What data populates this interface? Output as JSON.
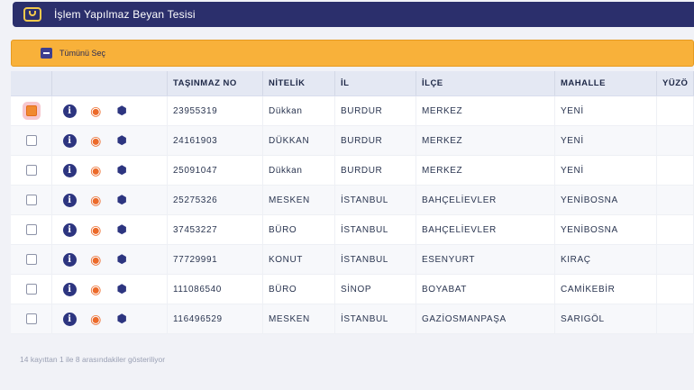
{
  "window": {
    "title": "İşlem Yapılmaz Beyan Tesisi"
  },
  "toolbar": {
    "select_all_label": "Tümünü Seç"
  },
  "table": {
    "headers": {
      "no": "TAŞINMAZ NO",
      "nitelik": "NİTELİK",
      "il": "İL",
      "ilce": "İLÇE",
      "mahalle": "MAHALLE",
      "yuzolcum": "YÜZÖ"
    },
    "rows": [
      {
        "no": "23955319",
        "nitelik": "Dükkan",
        "il": "BURDUR",
        "ilce": "MERKEZ",
        "mahalle": "YENİ",
        "checked": true
      },
      {
        "no": "24161903",
        "nitelik": "DÜKKAN",
        "il": "BURDUR",
        "ilce": "MERKEZ",
        "mahalle": "YENİ",
        "checked": false
      },
      {
        "no": "25091047",
        "nitelik": "Dükkan",
        "il": "BURDUR",
        "ilce": "MERKEZ",
        "mahalle": "YENİ",
        "checked": false
      },
      {
        "no": "25275326",
        "nitelik": "MESKEN",
        "il": "İSTANBUL",
        "ilce": "BAHÇELİEVLER",
        "mahalle": "YENİBOSNA",
        "checked": false
      },
      {
        "no": "37453227",
        "nitelik": "BÜRO",
        "il": "İSTANBUL",
        "ilce": "BAHÇELİEVLER",
        "mahalle": "YENİBOSNA",
        "checked": false
      },
      {
        "no": "77729991",
        "nitelik": "KONUT",
        "il": "İSTANBUL",
        "ilce": "ESENYURT",
        "mahalle": "KIRAÇ",
        "checked": false
      },
      {
        "no": "111086540",
        "nitelik": "BÜRO",
        "il": "SİNOP",
        "ilce": "BOYABAT",
        "mahalle": "CAMİKEBİR",
        "checked": false
      },
      {
        "no": "116496529",
        "nitelik": "MESKEN",
        "il": "İSTANBUL",
        "ilce": "GAZİOSMANPAŞA",
        "mahalle": "SARIGÖL",
        "checked": false
      }
    ]
  },
  "footer": {
    "status": "14 kayıttan 1 ile 8 arasındakiler gösteriliyor"
  },
  "icons": {
    "info": "info-icon",
    "location": "location-pin-icon",
    "parcel": "cube-icon",
    "window": "chat-box-icon"
  },
  "colors": {
    "titlebar": "#2b2f6c",
    "toolbar": "#f8b13a",
    "accent": "#ec6a2a"
  }
}
